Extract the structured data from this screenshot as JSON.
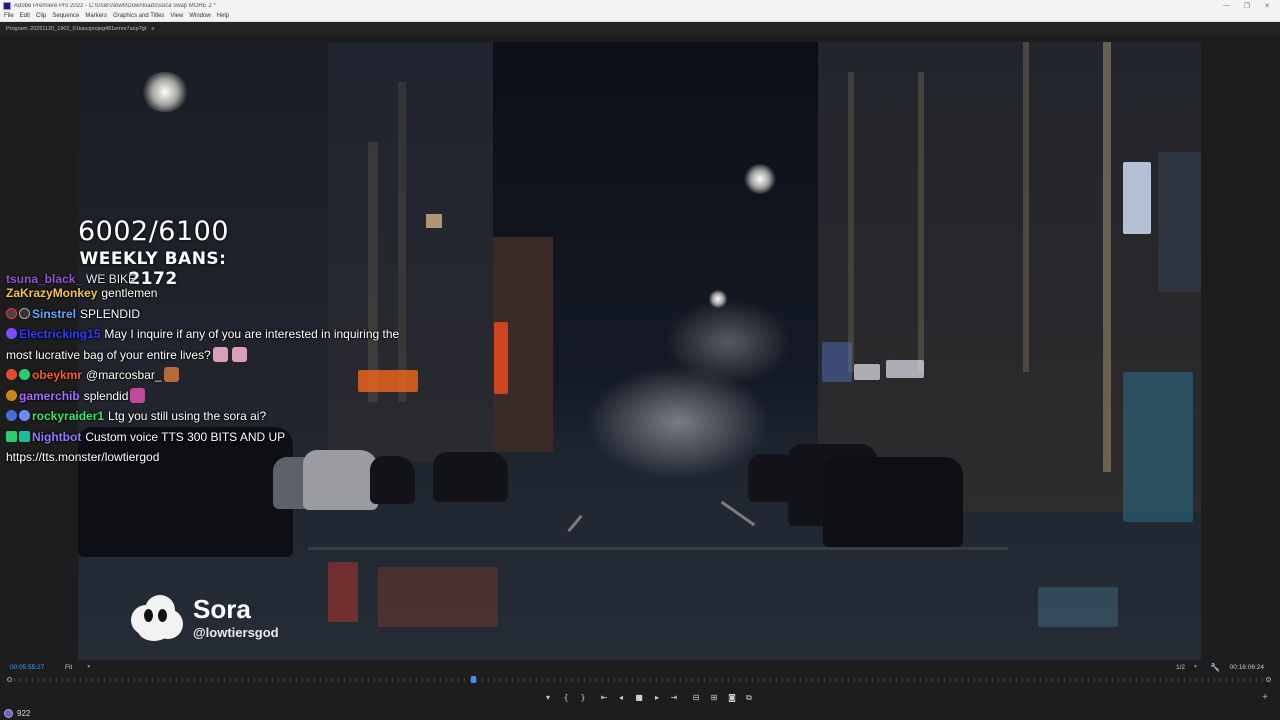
{
  "window": {
    "title": "Adobe Premiere Pro 2022 - C:\\Users\\lowti\\Downloads\\soca swap MORE 2 *",
    "controls": [
      "—",
      "❐",
      "✕"
    ]
  },
  "menu": [
    "File",
    "Edit",
    "Clip",
    "Sequence",
    "Markers",
    "Graphics and Titles",
    "View",
    "Window",
    "Help"
  ],
  "panel": {
    "label": "Program: 20251120_1902_01kacojoojeg481emnr7acp7gt",
    "menu_glyph": "≡"
  },
  "overlay": {
    "count": "6002/6100",
    "weekly": "WEEKLY BANS: 2172"
  },
  "chat": {
    "partial": {
      "name": "tsuna_black_",
      "text": "WE BIKE",
      "name_color": "#9b5de5"
    },
    "messages": [
      {
        "name": "ZaKrazyMonkey",
        "text": "gentlemen",
        "name_color": "#f4c542"
      },
      {
        "name": "Sinstrel",
        "text": "SPLENDID",
        "name_color": "#5fa8ff"
      },
      {
        "name": "Electricking15",
        "text": "May I inquire if any of you are interested in inquiring the most lucrative bag of your entire lives?",
        "name_color": "#2f3cff"
      },
      {
        "name": "obeykmr",
        "text": "@marcosbar_",
        "name_color": "#ff5a2a"
      },
      {
        "name": "gamerchib",
        "text": "splendid",
        "name_color": "#a36bff"
      },
      {
        "name": "rockyraider1",
        "text": "Ltg you still using the sora ai?",
        "name_color": "#2ee86a"
      },
      {
        "name": "Nightbot",
        "text": "Custom voice TTS 300 BITS AND UP https://tts.monster/lowtiergod",
        "name_color": "#8a7dff"
      }
    ]
  },
  "watermark": {
    "brand": "Sora",
    "handle": "@lowtiersgod"
  },
  "timebar": {
    "current_tc": "00:05:55:27",
    "fit": "Fit",
    "resolution": "1/2",
    "duration_tc": "00:16:06:24"
  },
  "playhead_fraction": 0.368,
  "transport": [
    {
      "name": "add-marker-icon",
      "glyph": "▾"
    },
    {
      "name": "mark-in-icon",
      "glyph": "{"
    },
    {
      "name": "mark-out-icon",
      "glyph": "}"
    },
    {
      "name": "go-to-in-icon",
      "glyph": "⇤"
    },
    {
      "name": "step-back-icon",
      "glyph": "◂"
    },
    {
      "name": "stop-icon",
      "glyph": "■"
    },
    {
      "name": "step-forward-icon",
      "glyph": "▸"
    },
    {
      "name": "go-to-out-icon",
      "glyph": "⇥"
    },
    {
      "name": "lift-icon",
      "glyph": "⊟"
    },
    {
      "name": "extract-icon",
      "glyph": "⊞"
    },
    {
      "name": "export-frame-icon",
      "glyph": "◙"
    },
    {
      "name": "comparison-view-icon",
      "glyph": "⧉"
    }
  ],
  "status": {
    "value": "922"
  },
  "colors": {
    "timecode_blue": "#3fa0ff",
    "playhead_blue": "#3f8dff",
    "panel_bg": "#1d1d1d"
  }
}
